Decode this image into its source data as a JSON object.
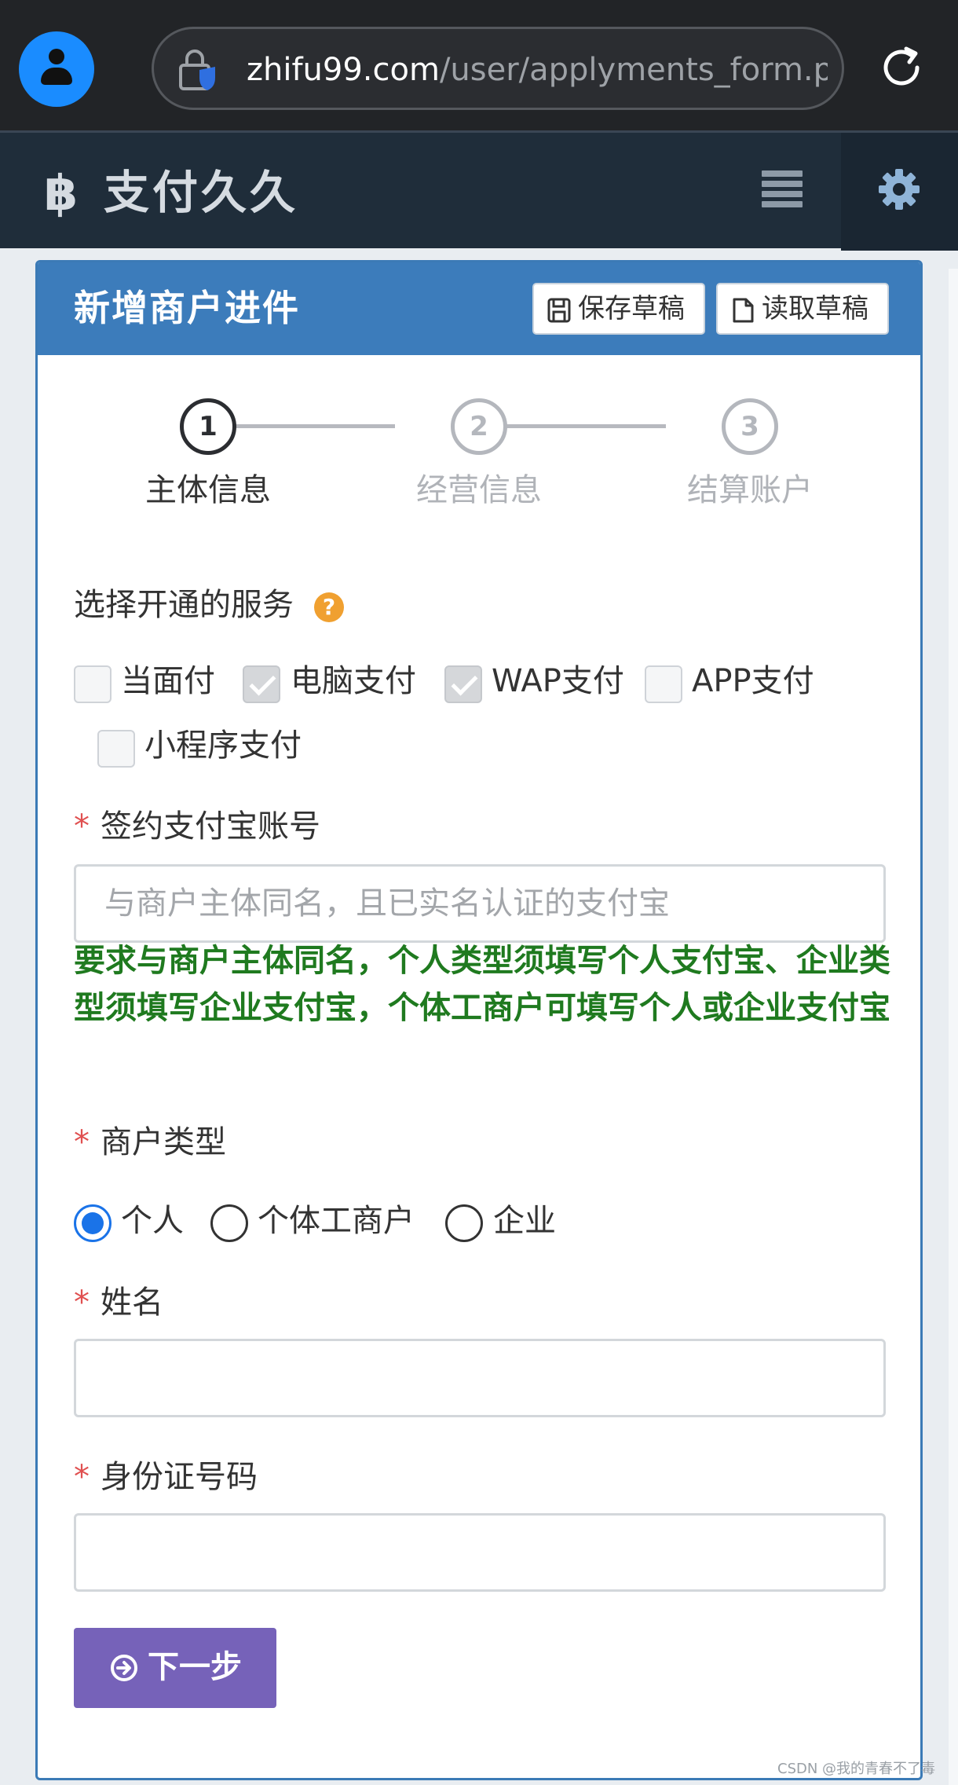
{
  "browser": {
    "url_host": "zhifu99.com",
    "url_path": "/user/applyments_form.php",
    "icons": [
      "avatar-icon",
      "lock-shield-icon",
      "reload-icon"
    ]
  },
  "app": {
    "brand_symbol": "฿",
    "brand_name": "支付久久",
    "icons": [
      "menu-icon",
      "gear-icon"
    ]
  },
  "panel": {
    "title": "新增商户进件",
    "save_draft": "保存草稿",
    "load_draft": "读取草稿"
  },
  "steps": [
    {
      "number": "1",
      "label": "主体信息",
      "active": true
    },
    {
      "number": "2",
      "label": "经营信息",
      "active": false
    },
    {
      "number": "3",
      "label": "结算账户",
      "active": false
    }
  ],
  "form": {
    "services_label": "选择开通的服务",
    "help_glyph": "?",
    "services": [
      {
        "label": "当面付",
        "checked": false
      },
      {
        "label": "电脑支付",
        "checked": true
      },
      {
        "label": "WAP支付",
        "checked": true
      },
      {
        "label": "APP支付",
        "checked": false
      },
      {
        "label": "小程序支付",
        "checked": false
      }
    ],
    "required_mark": "*",
    "alipay_label": "签约支付宝账号",
    "alipay_placeholder": "与商户主体同名，且已实名认证的支付宝",
    "alipay_hint": "要求与商户主体同名，个人类型须填写个人支付宝、企业类型须填写企业支付宝，个体工商户可填写个人或企业支付宝",
    "merchant_type_label": "商户类型",
    "merchant_types": [
      {
        "label": "个人",
        "selected": true
      },
      {
        "label": "个体工商户",
        "selected": false
      },
      {
        "label": "企业",
        "selected": false
      }
    ],
    "name_label": "姓名",
    "name_value": "",
    "id_label": "身份证号码",
    "id_value": "",
    "next_button": "下一步"
  },
  "watermark": "CSDN @我的青春不了毒",
  "colors": {
    "brand_blue": "#3c7cbb",
    "header_dark": "#1f2d3a",
    "next_purple": "#7662b9",
    "hint_green": "#1f7a1f",
    "required_red": "#e05050",
    "radio_blue": "#1a73e8"
  }
}
